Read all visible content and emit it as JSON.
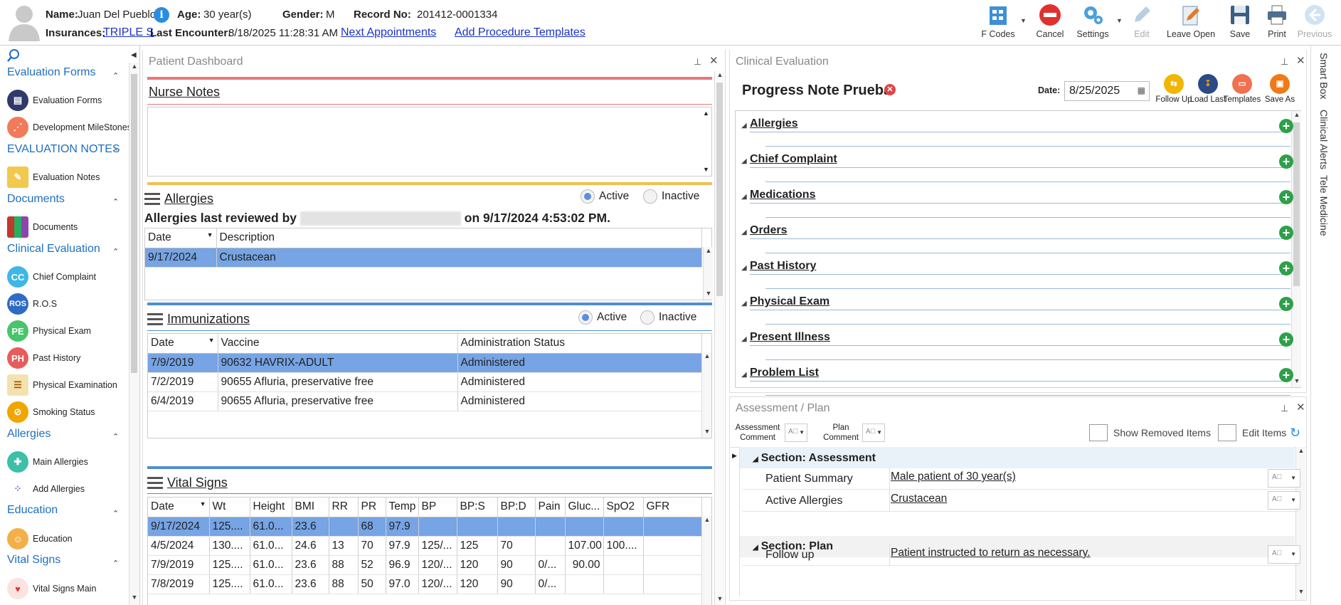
{
  "header": {
    "name_label": "Name:",
    "name": "Juan Del Pueblo",
    "age_label": "Age:",
    "age": "30 year(s)",
    "gender_label": "Gender:",
    "gender": "M",
    "record_label": "Record No:",
    "record": "201412-0001334",
    "insurances_label": "Insurances:",
    "insurance": "TRIPLE S",
    "last_encounter_label": "Last Encounter:",
    "last_encounter": "8/18/2025 11:28:31 AM",
    "next_appointments": "Next Appointments",
    "add_procedure_templates": "Add Procedure Templates"
  },
  "toolbar": {
    "fcodes": "F Codes",
    "cancel": "Cancel",
    "settings": "Settings",
    "edit": "Edit",
    "leave_open": "Leave Open",
    "save": "Save",
    "print": "Print",
    "previous": "Previous"
  },
  "sidebar": {
    "sections": [
      {
        "title": "Evaluation Forms",
        "items": [
          "Evaluation Forms",
          "Development MileStones"
        ]
      },
      {
        "title": "EVALUATION NOTES",
        "items": [
          "Evaluation Notes"
        ]
      },
      {
        "title": "Documents",
        "items": [
          "Documents"
        ]
      },
      {
        "title": "Clinical Evaluation",
        "items": [
          "Chief Complaint",
          "R.O.S",
          "Physical Exam",
          "Past History",
          "Physical Examination",
          "Smoking Status"
        ]
      },
      {
        "title": "Allergies",
        "items": [
          "Main Allergies",
          "Add Allergies"
        ]
      },
      {
        "title": "Education",
        "items": [
          "Education"
        ]
      },
      {
        "title": "Vital Signs",
        "items": [
          "Vital Signs Main"
        ]
      }
    ],
    "icon_texts": {
      "cc": "CC",
      "ros": "ROS",
      "pe": "PE",
      "ph": "PH"
    }
  },
  "dashboard": {
    "title": "Patient Dashboard",
    "nurse_notes": "Nurse Notes",
    "allergies": {
      "title": "Allergies",
      "active": "Active",
      "inactive": "Inactive",
      "reviewed_prefix": "Allergies last reviewed by",
      "reviewed_suffix": "on 9/17/2024 4:53:02 PM.",
      "columns": [
        "Date",
        "Description"
      ],
      "rows": [
        [
          "9/17/2024",
          "Crustacean"
        ]
      ]
    },
    "immunizations": {
      "title": "Immunizations",
      "active": "Active",
      "inactive": "Inactive",
      "columns": [
        "Date",
        "Vaccine",
        "Administration Status"
      ],
      "rows": [
        [
          "7/9/2019",
          "90632 HAVRIX-ADULT",
          "Administered"
        ],
        [
          "7/2/2019",
          "90655 Afluria, preservative free",
          "Administered"
        ],
        [
          "6/4/2019",
          "90655 Afluria, preservative free",
          "Administered"
        ]
      ]
    },
    "vitals": {
      "title": "Vital Signs",
      "columns": [
        "Date",
        "Wt",
        "Height",
        "BMI",
        "RR",
        "PR",
        "Temp",
        "BP",
        "BP:S",
        "BP:D",
        "Pain",
        "Gluc...",
        "SpO2",
        "GFR"
      ],
      "rows": [
        [
          "9/17/2024",
          "125....",
          "61.0...",
          "23.6",
          "",
          "68",
          "97.9",
          "",
          "",
          "",
          "",
          "",
          "",
          ""
        ],
        [
          "4/5/2024",
          "130....",
          "61.0...",
          "24.6",
          "13",
          "70",
          "97.9",
          "125/...",
          "125",
          "70",
          "",
          "107.00",
          "100....",
          ""
        ],
        [
          "7/9/2019",
          "125....",
          "61.0...",
          "23.6",
          "88",
          "52",
          "96.9",
          "120/...",
          "120",
          "90",
          "0/...",
          "90.00",
          "",
          ""
        ],
        [
          "7/8/2019",
          "125....",
          "61.0...",
          "23.6",
          "88",
          "50",
          "97.0",
          "120/...",
          "120",
          "90",
          "0/...",
          "",
          "",
          ""
        ]
      ]
    }
  },
  "clinical": {
    "title": "Clinical Evaluation",
    "note_title": "Progress Note Prueba",
    "date_label": "Date:",
    "date": "8/25/2025",
    "actions": [
      "Follow Up",
      "Load Last",
      "Templates",
      "Save As"
    ],
    "sections": [
      "Allergies",
      "Chief Complaint",
      "Medications",
      "Orders",
      "Past History",
      "Physical Exam",
      "Present Illness",
      "Problem List"
    ]
  },
  "assessment": {
    "title": "Assessment / Plan",
    "assessment_comment": "Assessment Comment",
    "plan_comment": "Plan Comment",
    "show_removed": "Show Removed Items",
    "edit_items": "Edit Items",
    "section_assessment": "Section: Assessment",
    "section_plan": "Section: Plan",
    "rows": [
      {
        "label": "Patient Summary",
        "value": "Male patient of 30 year(s)"
      },
      {
        "label": "Active Allergies",
        "value": "Crustacean"
      },
      {
        "label": "Follow up",
        "value": "Patient instructed to return as necessary."
      }
    ]
  },
  "right_tabs": [
    "Smart Box",
    "Clinical Alerts",
    "Tele Medicine"
  ],
  "colors": {
    "accent_blue": "#1e6fc0",
    "selected_row": "#76a4e4",
    "nurse_bar": "#e8767a",
    "allergy_bar": "#f2bf4f",
    "immun_bar": "#4f8fd0",
    "add_green": "#2ea04a"
  }
}
